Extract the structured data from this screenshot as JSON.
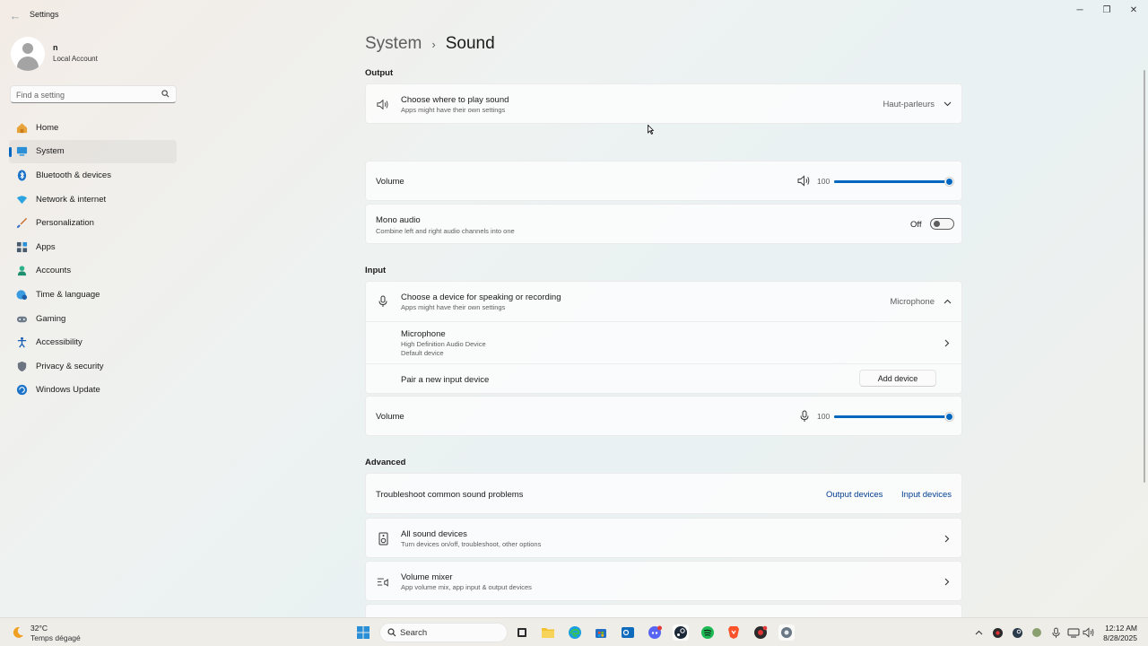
{
  "window": {
    "title": "Settings",
    "back_icon": "arrow-left-icon",
    "controls": [
      "minimize-icon",
      "restore-icon",
      "close-icon"
    ]
  },
  "user": {
    "name": "n",
    "account_type": "Local Account"
  },
  "search": {
    "placeholder": "Find a setting",
    "icon": "search-icon"
  },
  "sidebar": {
    "items": [
      {
        "label": "Home",
        "icon": "home-icon",
        "active": false
      },
      {
        "label": "System",
        "icon": "system-icon",
        "active": true
      },
      {
        "label": "Bluetooth & devices",
        "icon": "bluetooth-icon",
        "active": false
      },
      {
        "label": "Network & internet",
        "icon": "wifi-icon",
        "active": false
      },
      {
        "label": "Personalization",
        "icon": "brush-icon",
        "active": false
      },
      {
        "label": "Apps",
        "icon": "apps-icon",
        "active": false
      },
      {
        "label": "Accounts",
        "icon": "accounts-icon",
        "active": false
      },
      {
        "label": "Time & language",
        "icon": "globe-clock-icon",
        "active": false
      },
      {
        "label": "Gaming",
        "icon": "gamepad-icon",
        "active": false
      },
      {
        "label": "Accessibility",
        "icon": "accessibility-icon",
        "active": false
      },
      {
        "label": "Privacy & security",
        "icon": "shield-icon",
        "active": false
      },
      {
        "label": "Windows Update",
        "icon": "update-icon",
        "active": false
      }
    ]
  },
  "breadcrumb": {
    "parent": "System",
    "separator": "›",
    "current": "Sound"
  },
  "output": {
    "heading": "Output",
    "device_row": {
      "title": "Choose where to play sound",
      "subtitle": "Apps might have their own settings",
      "value": "Haut-parleurs",
      "icon": "speaker-icon",
      "expanded": false
    },
    "volume": {
      "label": "Volume",
      "value": "100",
      "level_percent": 100,
      "icon": "speaker-icon"
    },
    "mono_audio": {
      "title": "Mono audio",
      "subtitle": "Combine left and right audio channels into one",
      "state": "Off"
    }
  },
  "input": {
    "heading": "Input",
    "device_row": {
      "title": "Choose a device for speaking or recording",
      "subtitle": "Apps might have their own settings",
      "value": "Microphone",
      "icon": "microphone-icon",
      "expanded": true
    },
    "device": {
      "name": "Microphone",
      "description": "High Definition Audio Device",
      "status": "Default device"
    },
    "pair": {
      "label": "Pair a new input device",
      "button": "Add device"
    },
    "volume": {
      "label": "Volume",
      "value": "100",
      "level_percent": 100,
      "icon": "microphone-icon"
    }
  },
  "advanced": {
    "heading": "Advanced",
    "troubleshoot": {
      "label": "Troubleshoot common sound problems",
      "link_output": "Output devices",
      "link_input": "Input devices"
    },
    "all_devices": {
      "title": "All sound devices",
      "subtitle": "Turn devices on/off, troubleshoot, other options",
      "icon": "speaker-box-icon"
    },
    "mixer": {
      "title": "Volume mixer",
      "subtitle": "App volume mix, app input & output devices",
      "icon": "mixer-icon"
    }
  },
  "taskbar": {
    "weather": {
      "temp": "32°C",
      "desc": "Temps dégagé",
      "icon": "moon-icon"
    },
    "search_label": "Search",
    "pinned": [
      "windows-start-icon",
      "search-icon",
      "task-view-icon",
      "file-explorer-icon",
      "edge-icon",
      "store-icon",
      "outlook-icon",
      "discord-icon",
      "steam-icon",
      "spotify-icon",
      "brave-icon",
      "app-icon",
      "settings-icon"
    ],
    "tray": [
      "chevron-up-icon",
      "app-tray-icon",
      "steam-tray-icon",
      "network-tray-icon",
      "microphone-icon",
      "volume-icon",
      "speaker-icon",
      "battery-icon"
    ],
    "time": "12:12 AM",
    "date": "8/28/2025"
  }
}
